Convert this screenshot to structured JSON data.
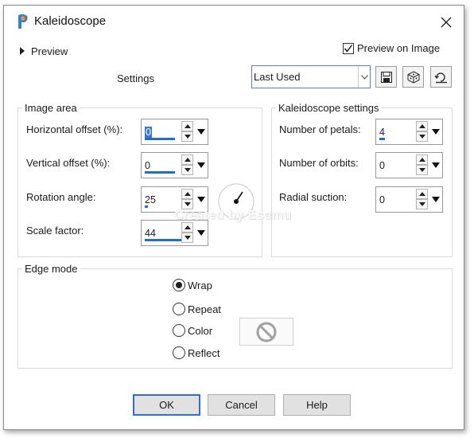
{
  "window": {
    "title": "Kaleidoscope"
  },
  "preview": {
    "label": "Preview",
    "on_image_label": "Preview on Image",
    "on_image_checked": true
  },
  "settings": {
    "label": "Settings",
    "preset_value": "Last Used"
  },
  "toolbar_icons": [
    "save-preset-icon",
    "randomize-dice-icon",
    "reset-icon"
  ],
  "image_area": {
    "title": "Image area",
    "horizontal_offset": {
      "label": "Horizontal offset (%):",
      "value": "0"
    },
    "vertical_offset": {
      "label": "Vertical offset (%):",
      "value": "0"
    },
    "rotation_angle": {
      "label": "Rotation angle:",
      "value": "25"
    },
    "scale_factor": {
      "label": "Scale factor:",
      "value": "44"
    }
  },
  "kaleidoscope_settings": {
    "title": "Kaleidoscope settings",
    "petals": {
      "label": "Number of petals:",
      "value": "4"
    },
    "orbits": {
      "label": "Number of orbits:",
      "value": "0"
    },
    "radial_suction": {
      "label": "Radial suction:",
      "value": "0"
    }
  },
  "watermark": "Created by Esamu",
  "edge_mode": {
    "title": "Edge mode",
    "options": [
      "Wrap",
      "Repeat",
      "Color",
      "Reflect"
    ],
    "selected": "Wrap"
  },
  "buttons": {
    "ok": "OK",
    "cancel": "Cancel",
    "help": "Help"
  },
  "colors": {
    "accent": "#1f6fd0",
    "selection": "#3a78d6"
  }
}
